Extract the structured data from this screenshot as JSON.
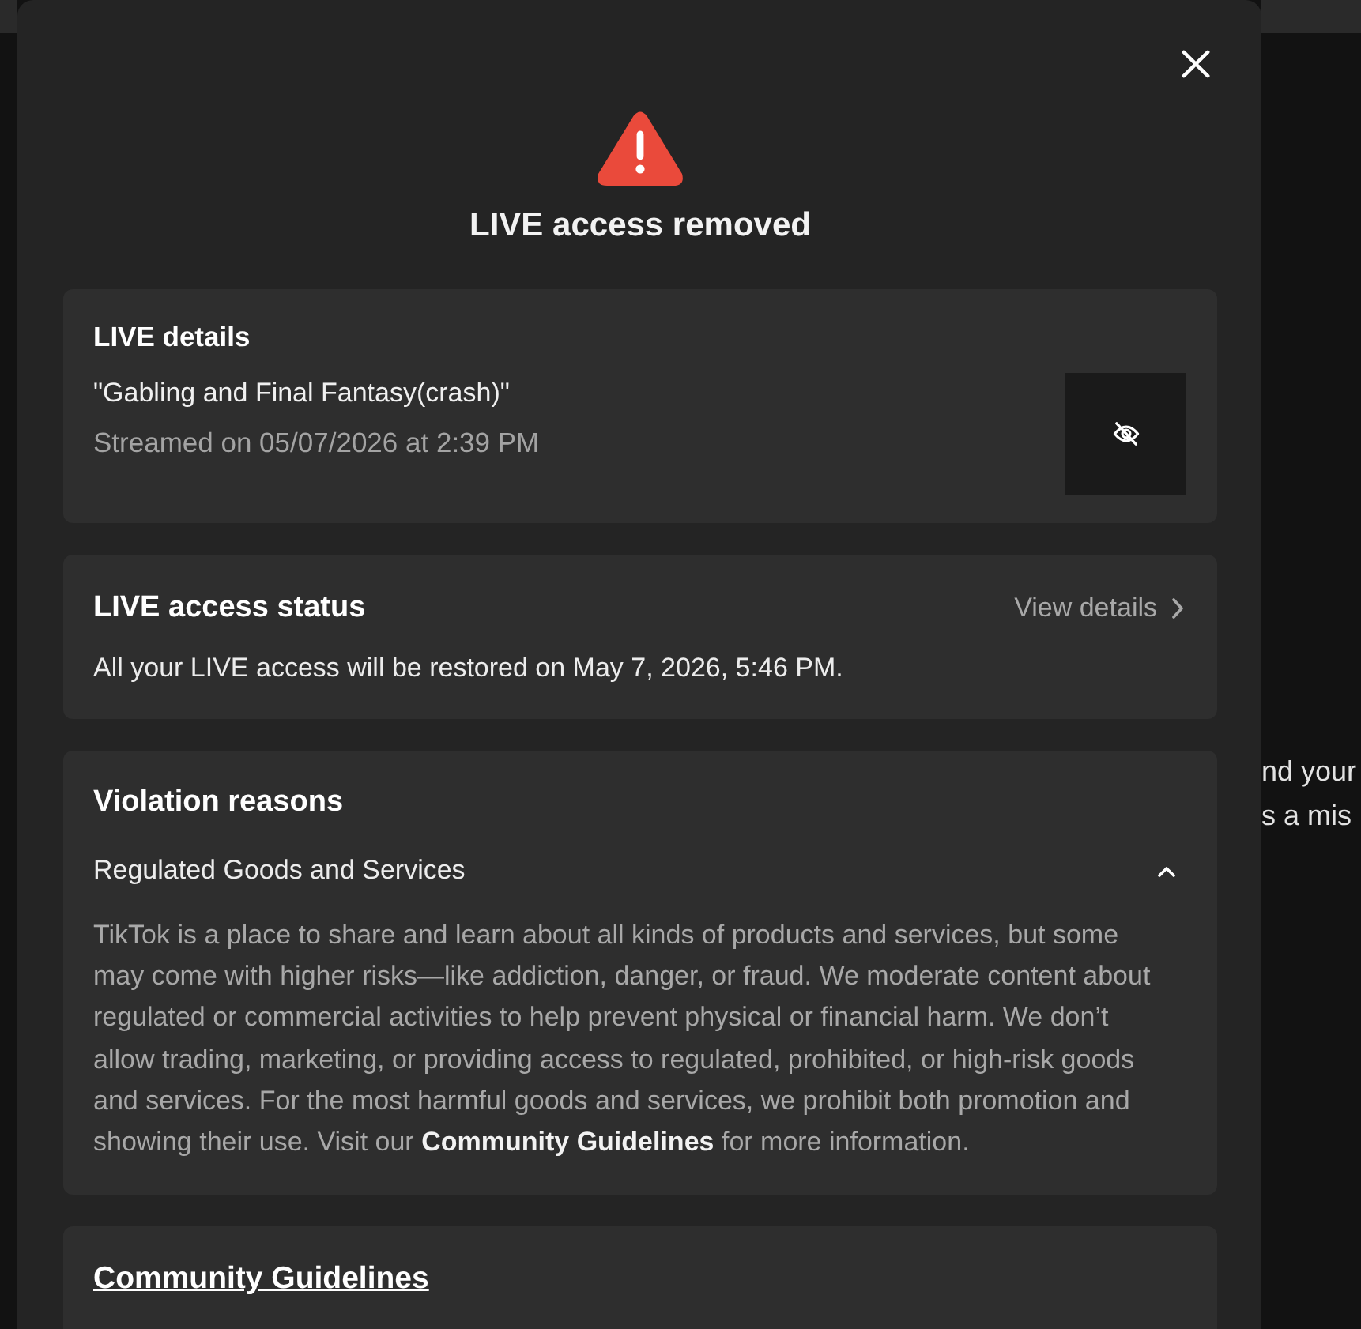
{
  "background_page": {
    "text_lines": [
      "nd your",
      "s a mis"
    ]
  },
  "dialog": {
    "title": "LIVE access removed",
    "live_details": {
      "heading": "LIVE details",
      "stream_title": "\"Gabling and Final Fantasy(crash)\"",
      "streamed_on": "Streamed on 05/07/2026 at 2:39 PM"
    },
    "access_status": {
      "heading": "LIVE access status",
      "link": "View details",
      "message": "All your LIVE access will be restored on May 7, 2026, 5:46 PM."
    },
    "violation_reasons": {
      "heading": "Violation reasons",
      "items": [
        {
          "title": "Regulated Goods and Services",
          "expanded": true,
          "description": [
            {
              "kind": "text",
              "text": "TikTok is a place to share and learn about all kinds of products and services, but some may come with higher risks—like addiction, danger, or fraud. We moderate content about regulated or commercial activities to help prevent physical or financial harm. We don’t allow trading, marketing, or providing access to regulated, prohibited, or high-risk goods and services. For the most harmful goods and services, we prohibit both promotion and showing their use. Visit our"
            },
            {
              "kind": "link",
              "text": "Community Guidelines"
            },
            {
              "kind": "text",
              "text": "for more information."
            }
          ]
        }
      ]
    },
    "community_guidelines": {
      "link": "Community Guidelines"
    }
  }
}
